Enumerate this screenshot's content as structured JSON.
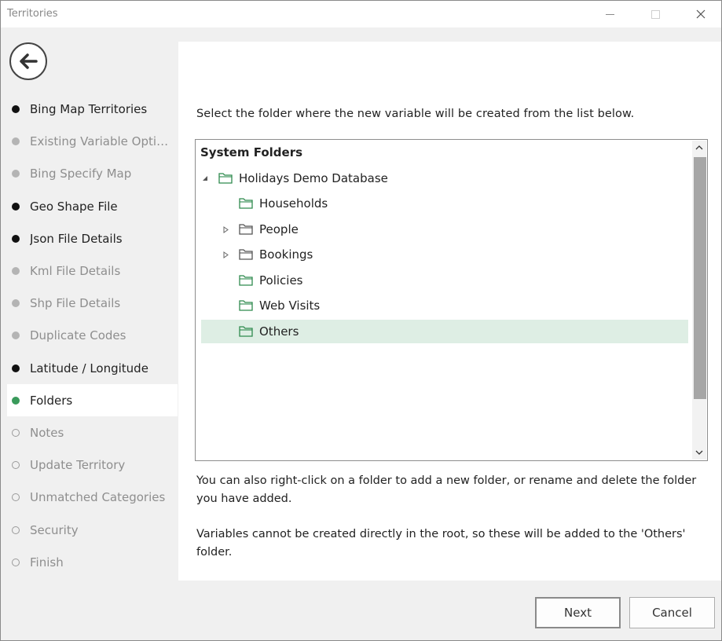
{
  "window": {
    "title": "Territories"
  },
  "steps": [
    {
      "label": "Bing Map Territories",
      "state": "done"
    },
    {
      "label": "Existing Variable Options",
      "state": "skipped"
    },
    {
      "label": "Bing Specify Map",
      "state": "skipped"
    },
    {
      "label": "Geo Shape File",
      "state": "done"
    },
    {
      "label": "Json File Details",
      "state": "done"
    },
    {
      "label": "Kml File Details",
      "state": "skipped"
    },
    {
      "label": "Shp File Details",
      "state": "skipped"
    },
    {
      "label": "Duplicate Codes",
      "state": "skipped"
    },
    {
      "label": "Latitude / Longitude",
      "state": "done"
    },
    {
      "label": "Folders",
      "state": "current"
    },
    {
      "label": "Notes",
      "state": "pending"
    },
    {
      "label": "Update Territory",
      "state": "pending"
    },
    {
      "label": "Unmatched Categories",
      "state": "pending"
    },
    {
      "label": "Security",
      "state": "pending"
    },
    {
      "label": "Finish",
      "state": "pending"
    }
  ],
  "main": {
    "instruction": "Select the folder where the new variable will be created from the list below.",
    "tree": {
      "header": "System Folders",
      "root": "Holidays Demo Database",
      "items": [
        {
          "label": "Households",
          "expandable": false,
          "selected": false
        },
        {
          "label": "People",
          "expandable": true,
          "selected": false
        },
        {
          "label": "Bookings",
          "expandable": true,
          "selected": false
        },
        {
          "label": "Policies",
          "expandable": false,
          "selected": false
        },
        {
          "label": "Web Visits",
          "expandable": false,
          "selected": false
        },
        {
          "label": "Others",
          "expandable": false,
          "selected": true
        }
      ]
    },
    "help_rename": "You can also right-click on a folder to add a new folder, or rename and delete the folder you have added.",
    "help_root": "Variables cannot be created directly in the root, so these will be added to the 'Others' folder."
  },
  "footer": {
    "next_label": "Next",
    "cancel_label": "Cancel"
  },
  "colors": {
    "accent": "#3a9a5b",
    "folder_stroke": "#2f8a4e",
    "selected_row": "#deeee4"
  },
  "icons": {
    "back": "arrow-left-circle-icon",
    "folder": "folder-outline-icon",
    "expand": "triangle-right-icon",
    "collapse": "triangle-down-icon"
  }
}
